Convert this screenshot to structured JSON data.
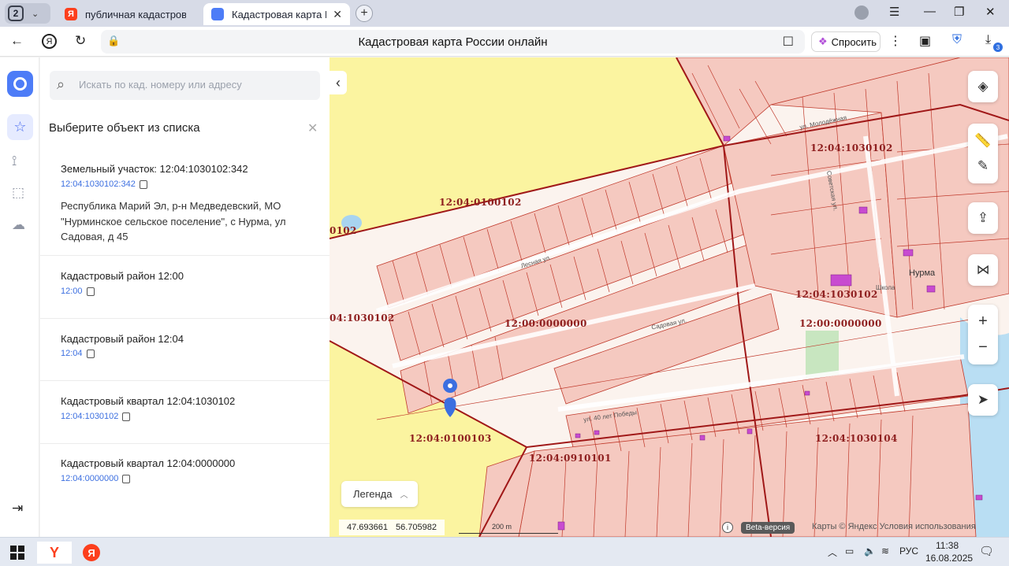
{
  "browser": {
    "tab_count": "2",
    "tabs": [
      {
        "title": "публичная кадастровая к",
        "active": false
      },
      {
        "title": "Кадастровая карта Рос",
        "active": true
      }
    ],
    "page_title": "Кадастровая карта России онлайн",
    "ask_button": "Спросить",
    "downloads_badge": "3"
  },
  "panel": {
    "search_placeholder": "Искать по кад. номеру или адресу",
    "title": "Выберите объект из списка",
    "items": [
      {
        "heading": "Земельный участок: 12:04:1030102:342",
        "sub": "12:04:1030102:342",
        "address": "Республика Марий Эл, р-н Медведевский, МО \"Нурминское сельское поселение\", с Нурма, ул Садовая, д 45"
      },
      {
        "heading": "Кадастровый район 12:00",
        "sub": "12:00"
      },
      {
        "heading": "Кадастровый район 12:04",
        "sub": "12:04"
      },
      {
        "heading": "Кадастровый квартал 12:04:1030102",
        "sub": "12:04:1030102"
      },
      {
        "heading": "Кадастровый квартал 12:04:0000000",
        "sub": "12:04:0000000"
      }
    ]
  },
  "map": {
    "labels": {
      "q1": "12:04:1030102",
      "q2": "12:04:0100102",
      "q3": "0102",
      "q4": "12:04:1030102",
      "q5": "12:00:0000000",
      "q6": "04:1030102",
      "q7": "12:00:0000000",
      "q8": "12:04:0100103",
      "q9": "12:04:1030104",
      "q10": "12:04:0910101"
    },
    "streets": {
      "s1": "Лесная ул.",
      "s2": "Садовая ул.",
      "s3": "ул. 40 лет Победы",
      "s4": "Нурма",
      "s5": "Школа",
      "s6": "ул. Молодёжная",
      "s7": "Советская ул."
    },
    "legend_label": "Легенда",
    "coord_lat": "47.693661",
    "coord_lon": "56.705982",
    "scale_label": "200 m",
    "beta_label": "Beta-версия",
    "copyright": "Карты © Яндекс   Условия использования",
    "colors": {
      "parcel_fill": "#f5c9c0",
      "parcel_border": "#c0392b",
      "district_fill": "#fbf4a0",
      "water": "#a8d4f0"
    }
  },
  "taskbar": {
    "lang": "РУС",
    "time": "11:38",
    "date": "16.08.2025"
  }
}
